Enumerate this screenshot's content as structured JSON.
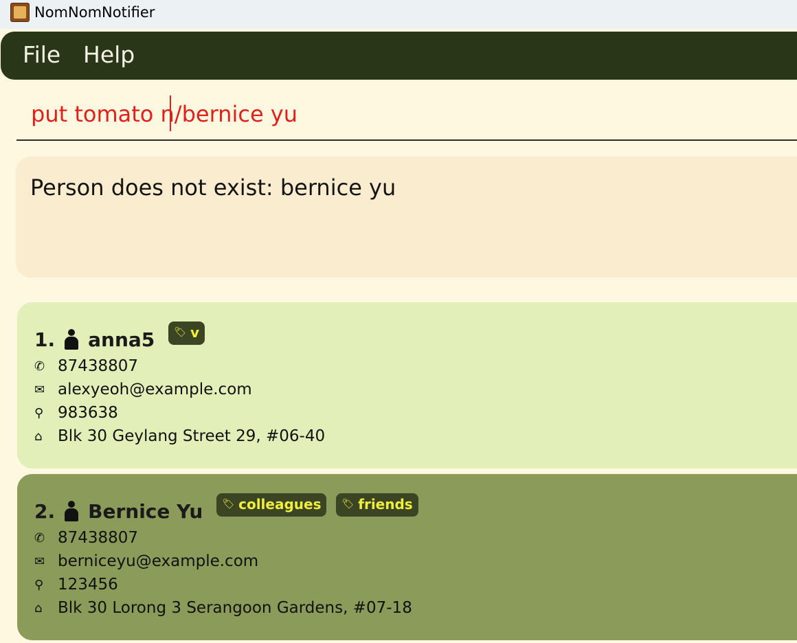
{
  "window": {
    "title": "NomNomNotifier",
    "icon": "app-icon"
  },
  "menu": {
    "items": [
      "File",
      "Help"
    ]
  },
  "command": {
    "value": "put tomato n/bernice yu"
  },
  "result": {
    "message": "Person does not exist: bernice yu"
  },
  "persons": [
    {
      "index": "1.",
      "name": "anna5",
      "tags": [
        "v"
      ],
      "phone": "87438807",
      "email": "alexyeoh@example.com",
      "postal": "983638",
      "address": "Blk 30 Geylang Street 29, #06-40",
      "background": "#e2efb9"
    },
    {
      "index": "2.",
      "name": "Bernice Yu",
      "tags": [
        "colleagues",
        "friends"
      ],
      "phone": "87438807",
      "email": "berniceyu@example.com",
      "postal": "123456",
      "address": "Blk 30 Lorong 3 Serangoon Gardens, #07-18",
      "background": "#8a9b5a"
    }
  ],
  "icons": {
    "tag": "tag-icon",
    "phone": "phone-icon",
    "email": "email-icon",
    "postal": "pin-icon",
    "address": "home-icon",
    "person": "person-icon"
  },
  "colors": {
    "menubar": "#2a3618",
    "command_text": "#e0211b",
    "tag_bg": "#3b4524",
    "tag_text": "#f0f03c"
  }
}
